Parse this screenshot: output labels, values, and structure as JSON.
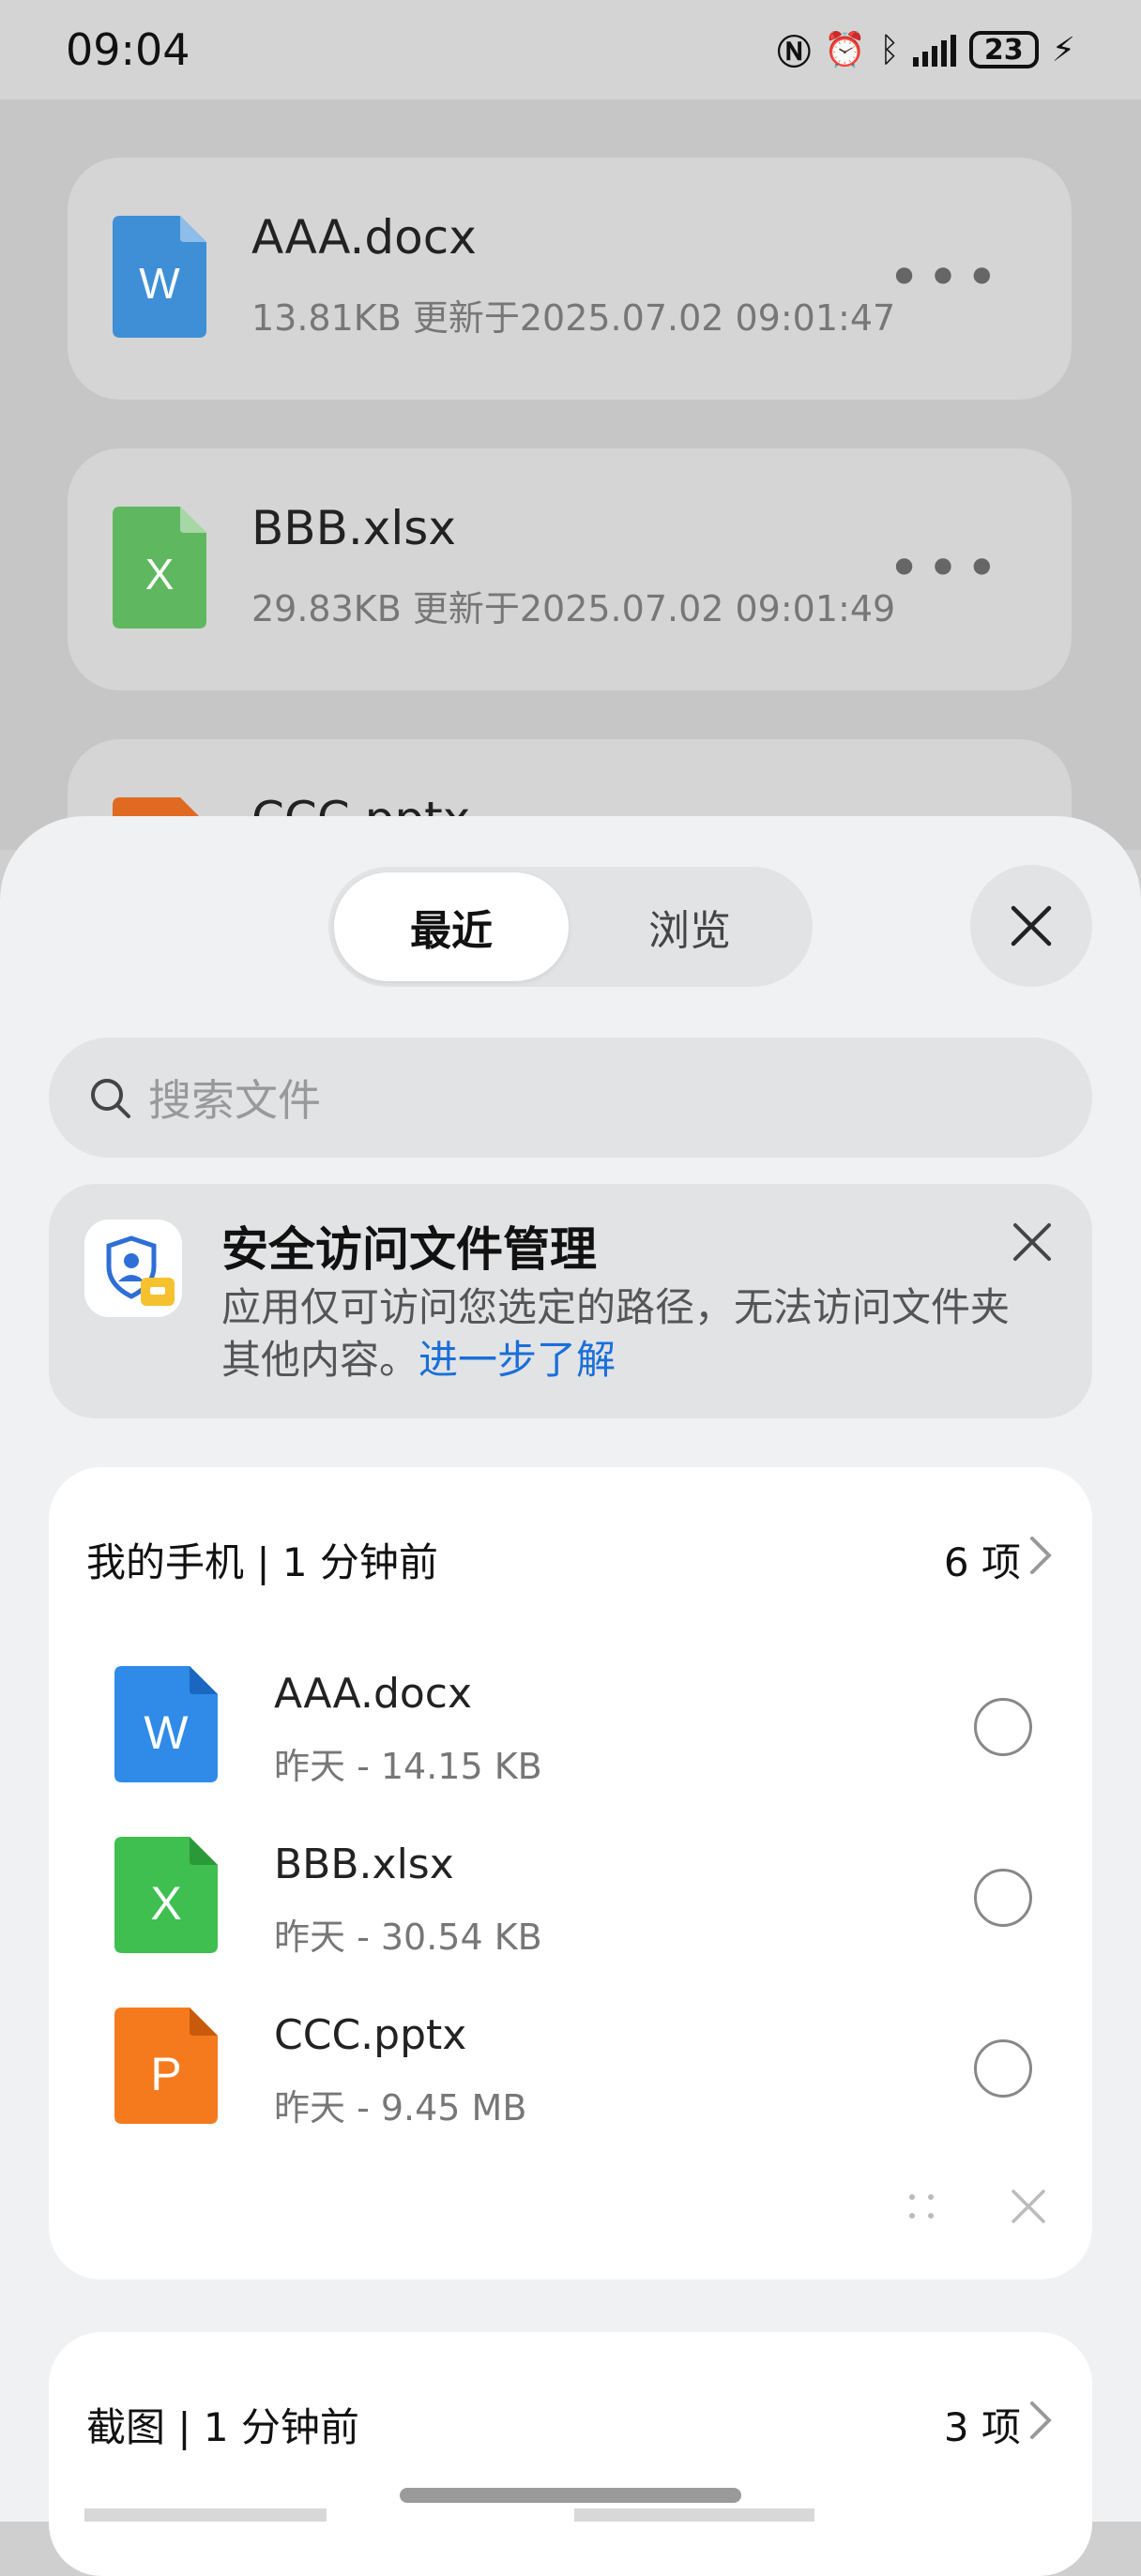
{
  "status": {
    "time": "09:04",
    "battery": "23"
  },
  "background_files": [
    {
      "name": "AAA.docx",
      "meta": "13.81KB   更新于2025.07.02 09:01:47",
      "type": "docx",
      "color": "#3f8fd6",
      "letter": "W"
    },
    {
      "name": "BBB.xlsx",
      "meta": "29.83KB   更新于2025.07.02 09:01:49",
      "type": "xlsx",
      "color": "#5fb85f",
      "letter": "X"
    },
    {
      "name": "CCC.pptx",
      "meta": "",
      "type": "pptx",
      "color": "#e06a22",
      "letter": "P"
    }
  ],
  "tabs": {
    "recent": "最近",
    "browse": "浏览"
  },
  "search": {
    "placeholder": "搜索文件"
  },
  "notice": {
    "title": "安全访问文件管理",
    "body": "应用仅可访问您选定的路径，无法访问文件夹其他内容。",
    "link": "进一步了解"
  },
  "phone_card": {
    "title": "我的手机 | 1 分钟前",
    "count": "6 项",
    "files": [
      {
        "name": "AAA.docx",
        "meta": "昨天 - 14.15 KB",
        "letter": "W",
        "color": "#2f8ae8"
      },
      {
        "name": "BBB.xlsx",
        "meta": "昨天 - 30.54 KB",
        "letter": "X",
        "color": "#3fbf4f"
      },
      {
        "name": "CCC.pptx",
        "meta": "昨天 - 9.45 MB",
        "letter": "P",
        "color": "#f57a1e"
      }
    ]
  },
  "screenshot_card": {
    "title": "截图 | 1 分钟前",
    "count": "3 项"
  },
  "colors": {
    "accent_link": "#1a6fd8"
  }
}
